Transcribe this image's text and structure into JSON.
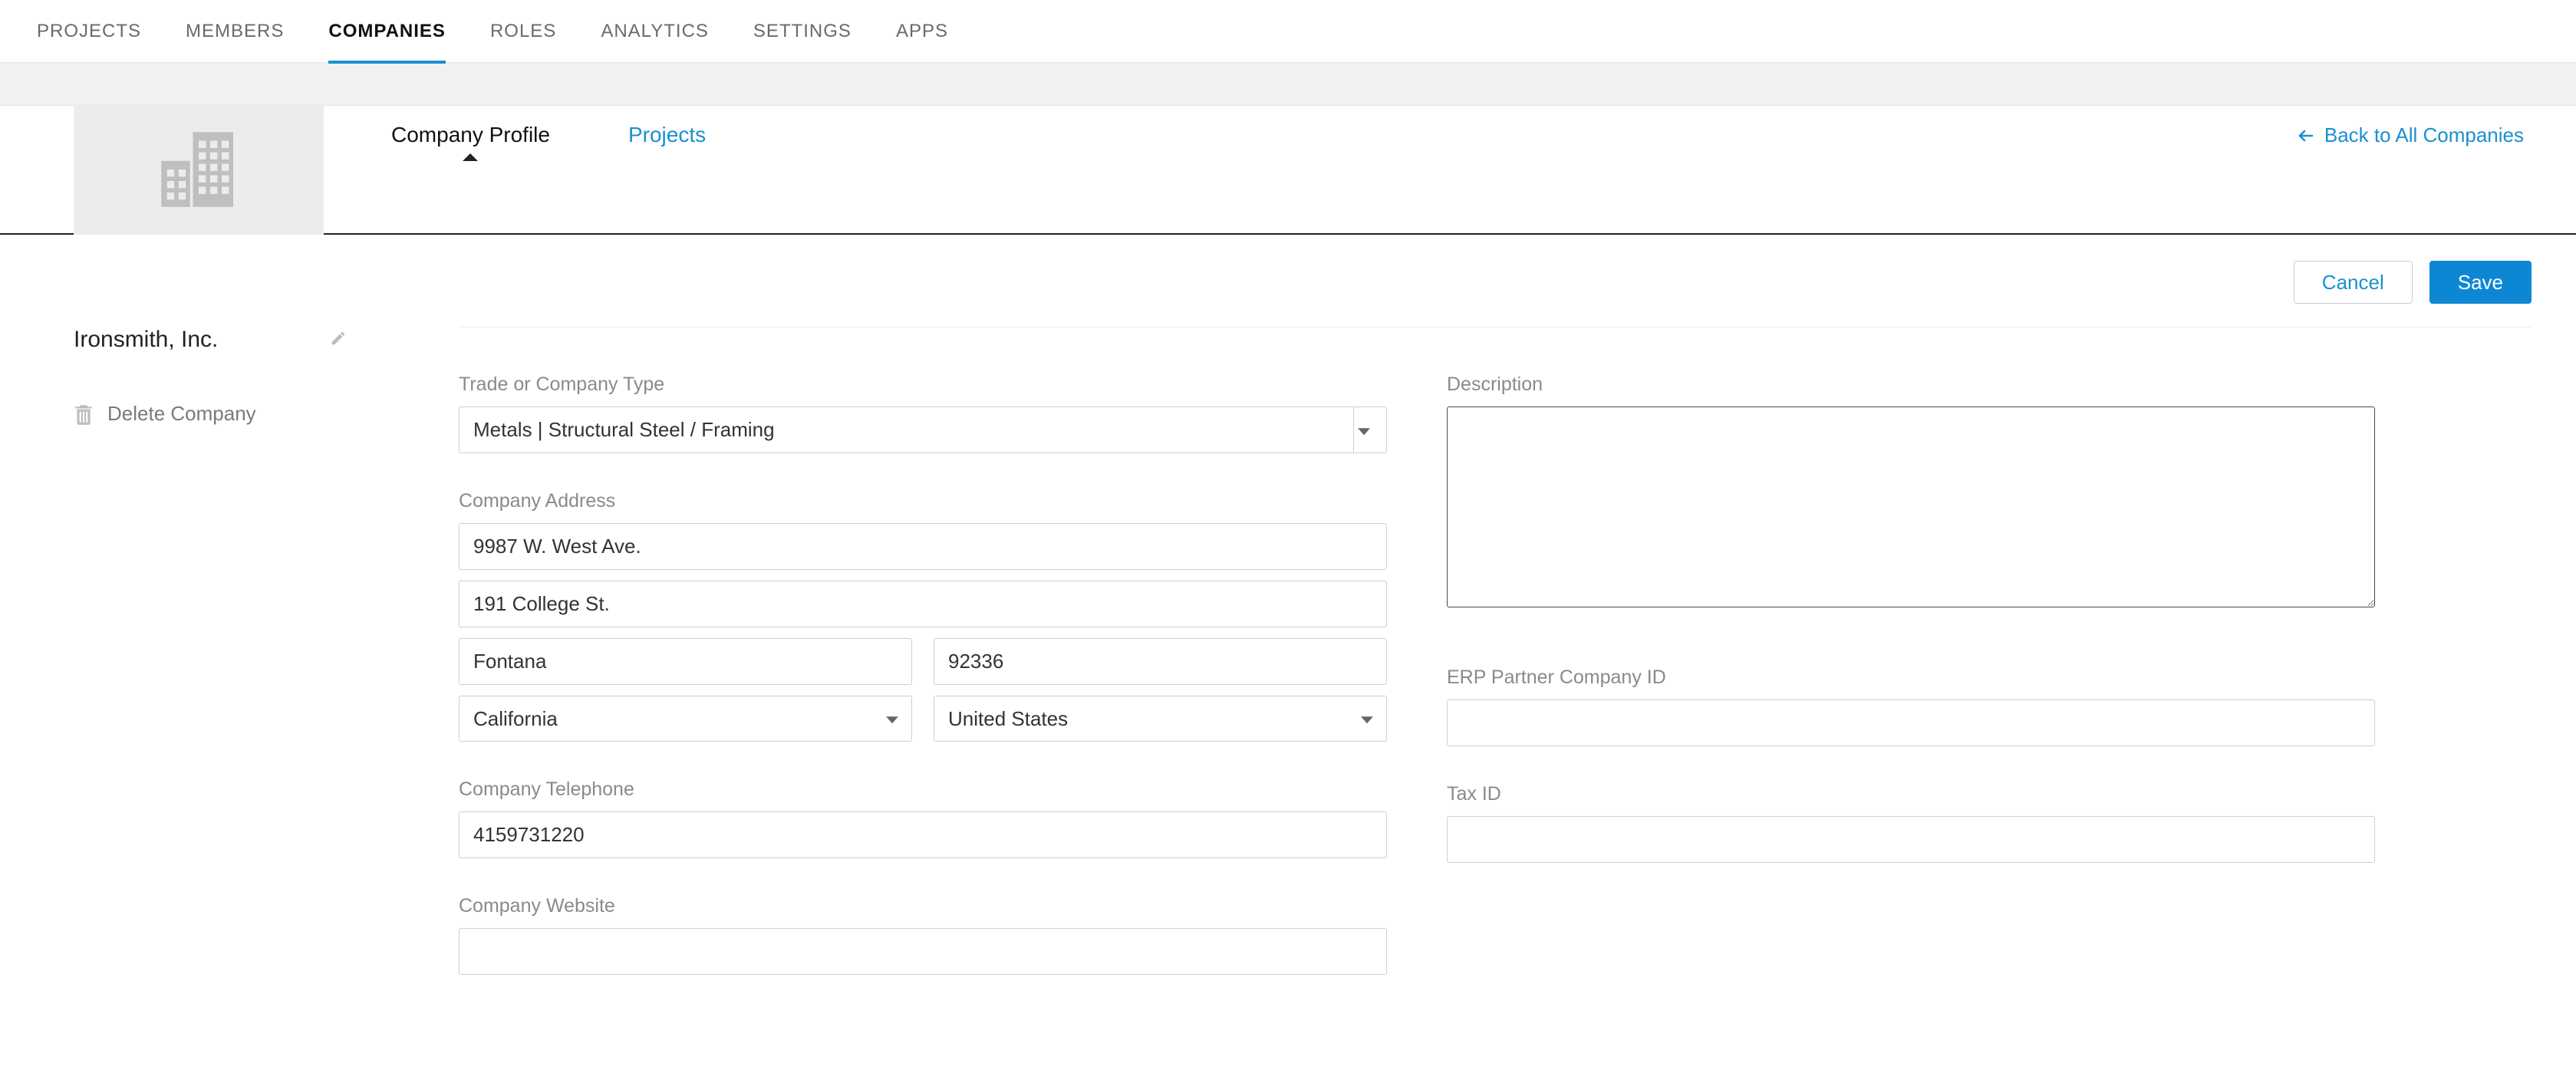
{
  "nav": {
    "items": [
      {
        "label": "PROJECTS"
      },
      {
        "label": "MEMBERS"
      },
      {
        "label": "COMPANIES"
      },
      {
        "label": "ROLES"
      },
      {
        "label": "ANALYTICS"
      },
      {
        "label": "SETTINGS"
      },
      {
        "label": "APPS"
      }
    ],
    "activeIndex": 2
  },
  "tabs": {
    "profile": "Company Profile",
    "projects": "Projects"
  },
  "back_link": "Back to All Companies",
  "actions": {
    "cancel": "Cancel",
    "save": "Save"
  },
  "sidebar": {
    "company_name": "Ironsmith, Inc.",
    "delete_label": "Delete Company"
  },
  "form": {
    "trade_label": "Trade or Company Type",
    "trade_value": "Metals | Structural Steel / Framing",
    "address_label": "Company Address",
    "address_line1": "9987 W. West Ave.",
    "address_line2": "191 College St.",
    "city": "Fontana",
    "postal": "92336",
    "state": "California",
    "country": "United States",
    "phone_label": "Company Telephone",
    "phone": "4159731220",
    "website_label": "Company Website",
    "website": "",
    "description_label": "Description",
    "description": "",
    "erp_label": "ERP Partner Company ID",
    "erp_value": "",
    "tax_label": "Tax ID",
    "tax_value": ""
  }
}
